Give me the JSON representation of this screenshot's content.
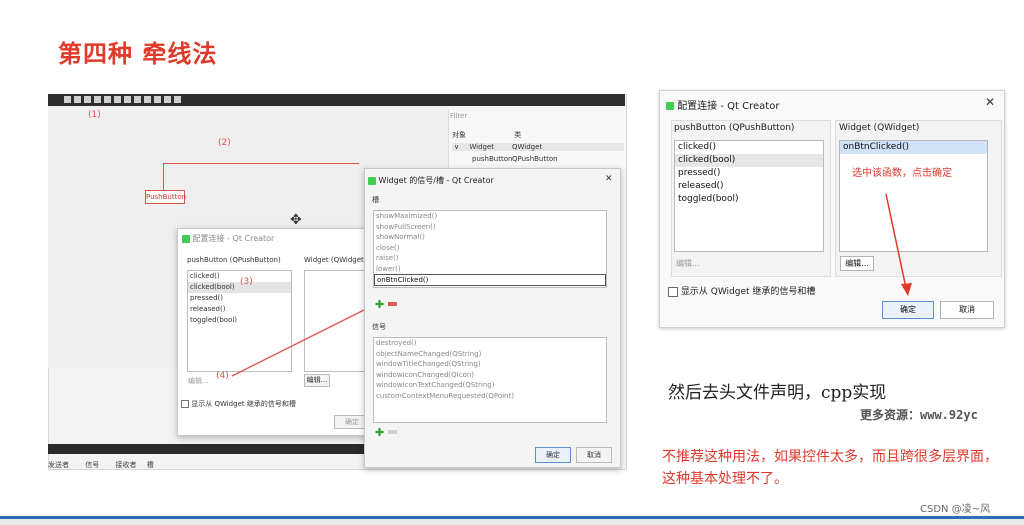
{
  "slide": {
    "title": "第四种 牵线法",
    "watermark": "CSDN @凌~风"
  },
  "designer": {
    "push_button_label": "PushButton",
    "marker_1": "(1)",
    "marker_2": "(2)",
    "marker_3": "(3)",
    "marker_4": "(4)",
    "inspector": {
      "filter_placeholder": "Filter",
      "col_object": "对象",
      "col_class": "类",
      "rows": [
        {
          "object": "Widget",
          "class": "QWidget"
        },
        {
          "object": "pushButton",
          "class": "QPushButton"
        }
      ]
    },
    "bottom_tabs": [
      "发送者",
      "信号",
      "接收者",
      "槽"
    ]
  },
  "small_dialog": {
    "title": "配置连接 - Qt Creator",
    "left_header": "pushButton (QPushButton)",
    "right_header": "Widget (QWidget)",
    "signals": [
      "clicked()",
      "clicked(bool)",
      "pressed()",
      "released()",
      "toggled(bool)"
    ],
    "edit_left": "编辑...",
    "edit_right": "编辑...",
    "show_inherited": "显示从 QWidget 继承的信号和槽",
    "ok": "确定"
  },
  "slots_dialog": {
    "title": "Widget 的信号/槽 - Qt Creator",
    "slots_label": "槽",
    "slots": [
      "showMaximized()",
      "showFullScreen()",
      "showNormal()",
      "close()",
      "raise()",
      "lower()",
      "onBtnClicked()"
    ],
    "signals_label": "信号",
    "signals": [
      "destroyed()",
      "objectNameChanged(QString)",
      "windowTitleChanged(QString)",
      "windowIconChanged(QIcon)",
      "windowIconTextChanged(QString)",
      "customContextMenuRequested(QPoint)"
    ],
    "ok": "确定",
    "cancel": "取消"
  },
  "config_dialog": {
    "title": "配置连接 - Qt Creator",
    "left_header": "pushButton (QPushButton)",
    "right_header": "Widget (QWidget)",
    "signals": [
      "clicked()",
      "clicked(bool)",
      "pressed()",
      "released()",
      "toggled(bool)"
    ],
    "slots": [
      "onBtnClicked()"
    ],
    "annotation": "选中该函数，点击确定",
    "edit_left": "编辑...",
    "edit_right": "编辑...",
    "show_inherited": "显示从 QWidget 继承的信号和槽",
    "ok": "确定",
    "cancel": "取消"
  },
  "notes": {
    "line1": "然后去头文件声明，cpp实现",
    "line2": "更多资源：www.92yc",
    "line3": "不推荐这种用法，如果控件太多，而且跨很多层界面，这种基本处理不了。"
  },
  "colors": {
    "accent_red": "#e03a2a",
    "footer_blue": "#2a6db8"
  }
}
